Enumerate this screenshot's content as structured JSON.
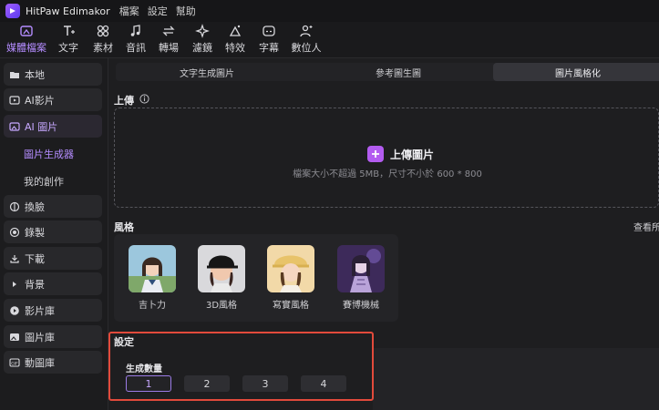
{
  "titlebar": {
    "app_name": "HitPaw Edimakor",
    "menu": [
      "檔案",
      "設定",
      "幫助"
    ]
  },
  "toolbar": {
    "items": [
      {
        "label": "媒體檔案",
        "icon": "media-icon",
        "active": true
      },
      {
        "label": "文字",
        "icon": "text-icon"
      },
      {
        "label": "素材",
        "icon": "materials-icon"
      },
      {
        "label": "音訊",
        "icon": "audio-icon"
      },
      {
        "label": "轉場",
        "icon": "transition-icon"
      },
      {
        "label": "濾鏡",
        "icon": "filter-icon"
      },
      {
        "label": "特效",
        "icon": "effects-icon"
      },
      {
        "label": "字幕",
        "icon": "subtitle-icon"
      },
      {
        "label": "數位人",
        "icon": "digital-human-icon"
      }
    ]
  },
  "sidebar": {
    "items": [
      {
        "label": "本地",
        "icon": "folder-icon"
      },
      {
        "label": "AI影片",
        "icon": "ai-video-icon"
      },
      {
        "label": "AI 圖片",
        "icon": "ai-image-icon",
        "active": true
      },
      {
        "label": "換臉",
        "icon": "face-swap-icon"
      },
      {
        "label": "錄製",
        "icon": "record-icon"
      },
      {
        "label": "下載",
        "icon": "download-icon"
      },
      {
        "label": "背景",
        "icon": "background-icon"
      },
      {
        "label": "影片庫",
        "icon": "video-library-icon"
      },
      {
        "label": "圖片庫",
        "icon": "image-library-icon"
      },
      {
        "label": "動圖庫",
        "icon": "gif-library-icon"
      }
    ],
    "sub_items": [
      {
        "label": "圖片生成器",
        "active": true
      },
      {
        "label": "我的創作"
      }
    ]
  },
  "tabs": [
    {
      "label": "文字生成圖片"
    },
    {
      "label": "參考圖生圖"
    },
    {
      "label": "圖片風格化",
      "active": true
    }
  ],
  "upload": {
    "section_label": "上傳",
    "button_label": "上傳圖片",
    "hint": "檔案大小不超過 5MB，尺寸不小於 600 * 800"
  },
  "style": {
    "section_label": "風格",
    "view_all": "查看所",
    "options": [
      {
        "label": "吉卜力"
      },
      {
        "label": "3D風格"
      },
      {
        "label": "寫實風格"
      },
      {
        "label": "賽博機械"
      }
    ]
  },
  "settings": {
    "section_label": "設定",
    "count_label": "生成數量",
    "count_options": [
      "1",
      "2",
      "3",
      "4"
    ],
    "selected_count": "1"
  },
  "colors": {
    "accent": "#b48cff",
    "highlight_frame": "#e24a3b",
    "upload_plus": "#b35cf0"
  }
}
